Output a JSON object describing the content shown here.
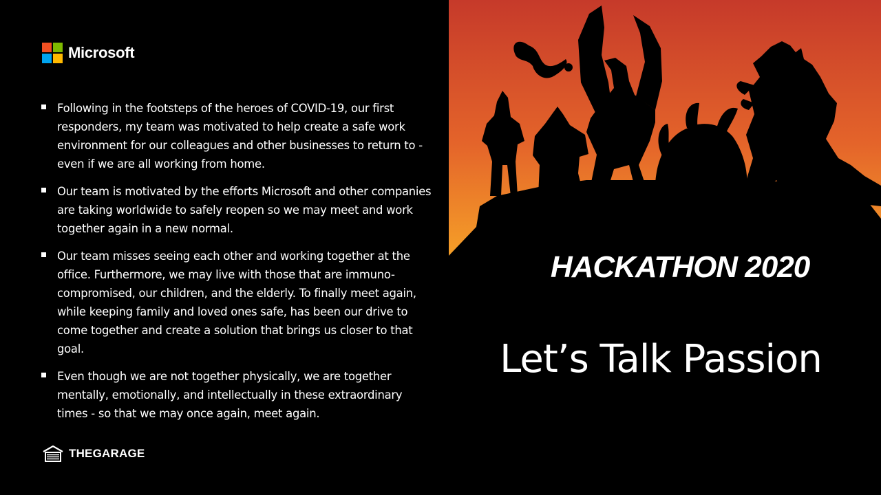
{
  "brand": {
    "name": "Microsoft",
    "colors": {
      "red": "#F25022",
      "green": "#7FBA00",
      "blue": "#00A4EF",
      "yellow": "#FFB900"
    }
  },
  "bullets": [
    "Following in the footsteps of the heroes of COVID-19, our first responders, my team was motivated to help create a safe work environment for our colleagues and other businesses to return to - even if we are all working from home.",
    "Our team is motivated by the efforts Microsoft and other companies are taking worldwide to safely reopen so we may meet and work together again in a new normal.",
    "Our team misses seeing each other and working together at the office. Furthermore, we may live with those that are immuno-compromised, our children, and the elderly. To finally meet again, while keeping family and loved ones safe, has been our drive to come together and create a solution that brings us closer to that goal.",
    "Even though we are not together physically, we are together mentally, emotionally, and intellectually in these extraordinary times - so that we may once again, meet again."
  ],
  "footer": {
    "logo_text": "THEGARAGE",
    "icon": "garage-icon"
  },
  "hero": {
    "icon": "hero-silhouettes-illustration",
    "sky_top": "#C8402A",
    "sky_bottom": "#F39A22"
  },
  "hackathon_title": "HACKATHON 2020",
  "tagline": "Let’s Talk Passion"
}
